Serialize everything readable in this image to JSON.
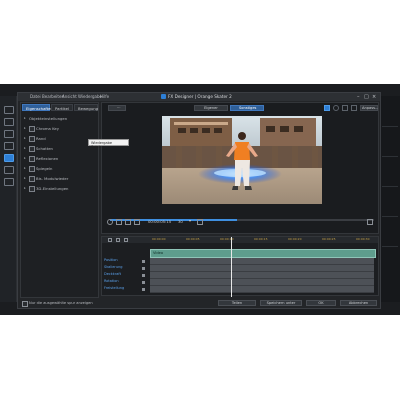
{
  "window": {
    "title": "FX Designer | Orange Skater 2",
    "menu": [
      "Datei",
      "Bearbeiten",
      "Ansicht",
      "Wiedergabe",
      "Hilfe"
    ]
  },
  "left_panel": {
    "tabs": [
      "Eigenschaften",
      "Partikel",
      "Bewegung"
    ],
    "active_tab": "Eigenschaften",
    "items": [
      {
        "label": "Objekteinstellungen",
        "has_checkbox": false
      },
      {
        "label": "Chroma Key",
        "has_checkbox": true
      },
      {
        "label": "Rand",
        "has_checkbox": true
      },
      {
        "label": "Schatten",
        "has_checkbox": true
      },
      {
        "label": "Reflexionen",
        "has_checkbox": true
      },
      {
        "label": "Spiegeln",
        "has_checkbox": true
      },
      {
        "label": "Bis. Modulwieder",
        "has_checkbox": true
      },
      {
        "label": "3D-Einstellungen",
        "has_checkbox": true
      }
    ]
  },
  "preview": {
    "buttons": [
      "Eigener",
      "Sonstiges"
    ],
    "active_button": "Sonstiges",
    "zoom_label": "Anpass...",
    "progress": 0.48
  },
  "controls": {
    "timecode": "00:00:05:15",
    "fps": "30",
    "tooltip": "Wiedergabe Spielen"
  },
  "timeline": {
    "ruler": [
      "00:00:00",
      "00:00:05",
      "00:00:10",
      "00:00:15",
      "00:00:20",
      "00:00:25",
      "00:00:30"
    ],
    "tracks": [
      "Position",
      "Skalierung",
      "Deckkraft",
      "Rotation",
      "Freistellung"
    ],
    "clip_label": "Video",
    "playhead_fraction": 0.36
  },
  "bottom_bar": {
    "checkbox_label": "Nur die ausgewählte spur anzeigen",
    "buttons": [
      "Teilen",
      "Speichern unter",
      "OK",
      "Abbrechen"
    ]
  }
}
